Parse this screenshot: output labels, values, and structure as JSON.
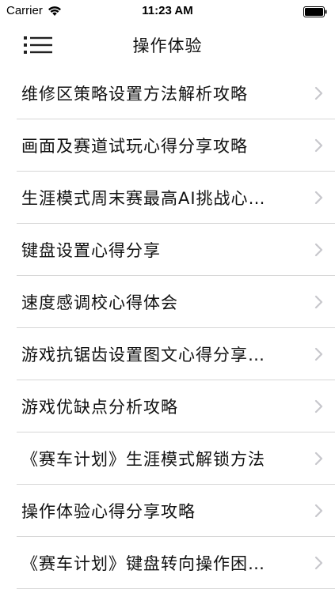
{
  "status_bar": {
    "carrier": "Carrier",
    "time": "11:23 AM",
    "wifi_icon": "wifi-icon",
    "battery_icon": "battery-icon"
  },
  "nav_bar": {
    "title": "操作体验",
    "menu_icon": "list-menu-icon"
  },
  "list": {
    "items": [
      {
        "label": "维修区策略设置方法解析攻略"
      },
      {
        "label": "画面及赛道试玩心得分享攻略"
      },
      {
        "label": "生涯模式周末赛最高AI挑战心…"
      },
      {
        "label": "键盘设置心得分享"
      },
      {
        "label": "速度感调校心得体会"
      },
      {
        "label": "游戏抗锯齿设置图文心得分享…"
      },
      {
        "label": "游戏优缺点分析攻略"
      },
      {
        "label": "《赛车计划》生涯模式解锁方法"
      },
      {
        "label": "操作体验心得分享攻略"
      },
      {
        "label": "《赛车计划》键盘转向操作困…"
      }
    ],
    "chevron_icon": "chevron-right-icon"
  },
  "colors": {
    "background": "#ffffff",
    "text": "#111111",
    "separator": "#d6d6d6",
    "chevron": "#c7c7cc"
  }
}
